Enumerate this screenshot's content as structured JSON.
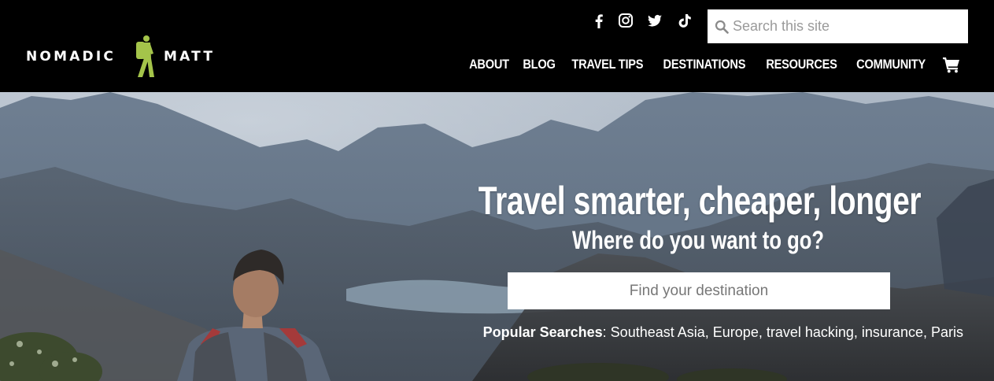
{
  "brand": {
    "name_left": "NOMADIC",
    "name_right": "MATT",
    "accent": "#a4c44a"
  },
  "social": [
    {
      "icon": "facebook-icon"
    },
    {
      "icon": "instagram-icon"
    },
    {
      "icon": "twitter-icon"
    },
    {
      "icon": "tiktok-icon"
    }
  ],
  "site_search": {
    "placeholder": "Search this site",
    "value": ""
  },
  "nav": {
    "items": [
      "ABOUT",
      "BLOG",
      "TRAVEL TIPS",
      "DESTINATIONS",
      "RESOURCES",
      "COMMUNITY"
    ],
    "cart_icon": "shopping-cart-icon"
  },
  "hero": {
    "title": "Travel smarter, cheaper, longer",
    "subtitle": "Where do you want to go?",
    "destination_placeholder": "Find your destination",
    "destination_value": "",
    "popular_label": "Popular Searches",
    "popular_separator": ": ",
    "popular_links": [
      "Southeast Asia",
      "Europe",
      "travel hacking",
      "insurance",
      "Paris"
    ]
  },
  "colors": {
    "header_bg": "#000000",
    "text": "#ffffff"
  }
}
